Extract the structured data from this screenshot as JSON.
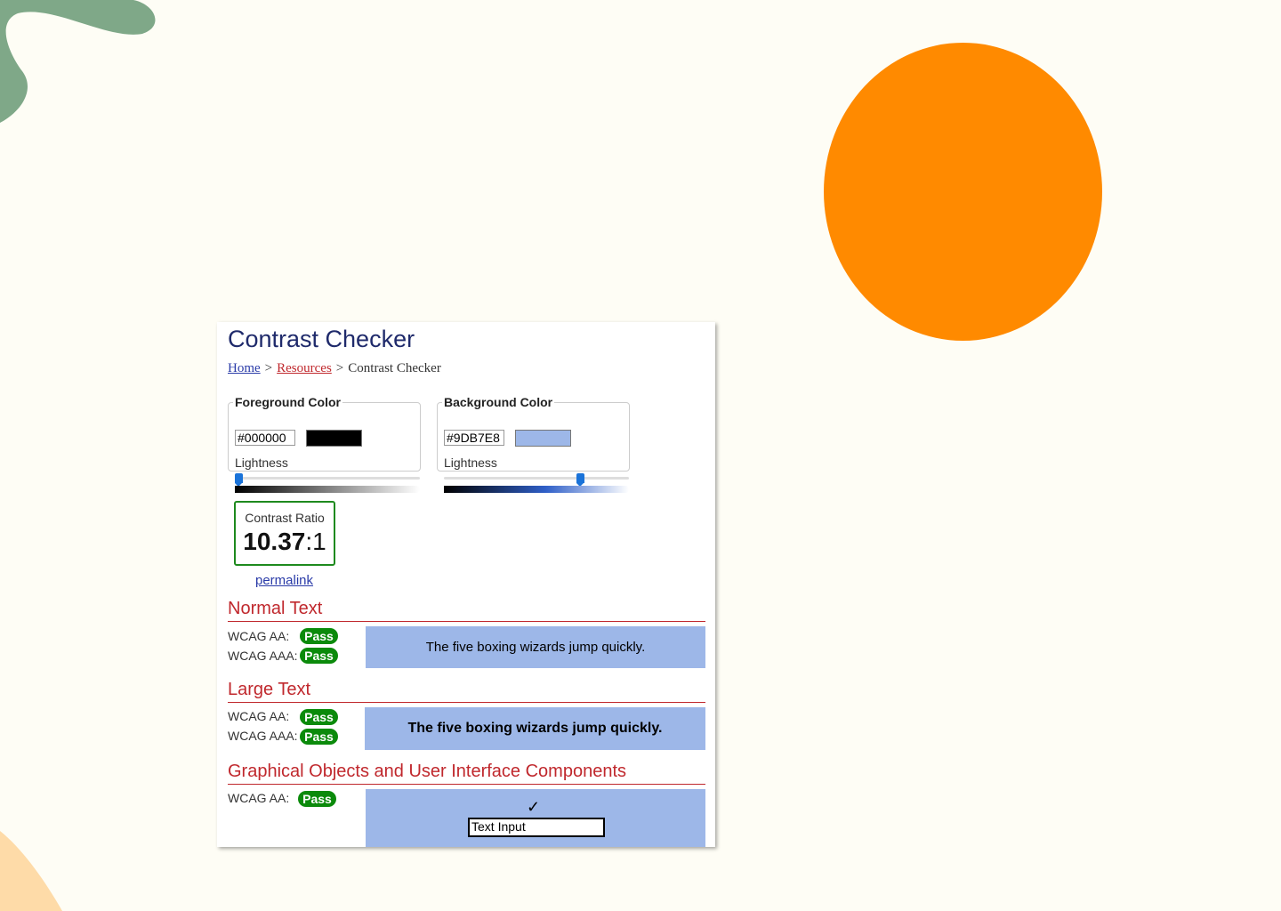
{
  "page": {
    "title": "Contrast Checker",
    "breadcrumb": {
      "home": "Home",
      "separator": ">",
      "resources": "Resources",
      "current": "Contrast Checker"
    }
  },
  "foreground": {
    "legend": "Foreground Color",
    "hex": "#000000",
    "swatch_color": "#000000",
    "lightness_label": "Lightness",
    "lightness_value": 0
  },
  "background": {
    "legend": "Background Color",
    "hex": "#9DB7E8",
    "swatch_color": "#9DB7E8",
    "lightness_label": "Lightness",
    "lightness_value": 0.75
  },
  "contrast": {
    "label": "Contrast Ratio",
    "ratio": "10.37",
    "suffix": ":1",
    "permalink": "permalink"
  },
  "normal_text": {
    "heading": "Normal Text",
    "aa_label": "WCAG AA:",
    "aa_result": "Pass",
    "aaa_label": "WCAG AAA:",
    "aaa_result": "Pass",
    "sample": "The five boxing wizards jump quickly."
  },
  "large_text": {
    "heading": "Large Text",
    "aa_label": "WCAG AA:",
    "aa_result": "Pass",
    "aaa_label": "WCAG AAA:",
    "aaa_result": "Pass",
    "sample": "The five boxing wizards jump quickly."
  },
  "graphical": {
    "heading": "Graphical Objects and User Interface Components",
    "aa_label": "WCAG AA:",
    "aa_result": "Pass",
    "check_icon": "✓",
    "input_value": "Text Input"
  },
  "colors": {
    "page_bg": "#FEFDF5",
    "orange_circle": "#FF8A00",
    "deco_green": "#7FA888",
    "deco_peach": "#FEDBA8",
    "pass_green": "#0B8A0B",
    "heading_red": "#C0282D",
    "title_navy": "#1F2A6B"
  }
}
